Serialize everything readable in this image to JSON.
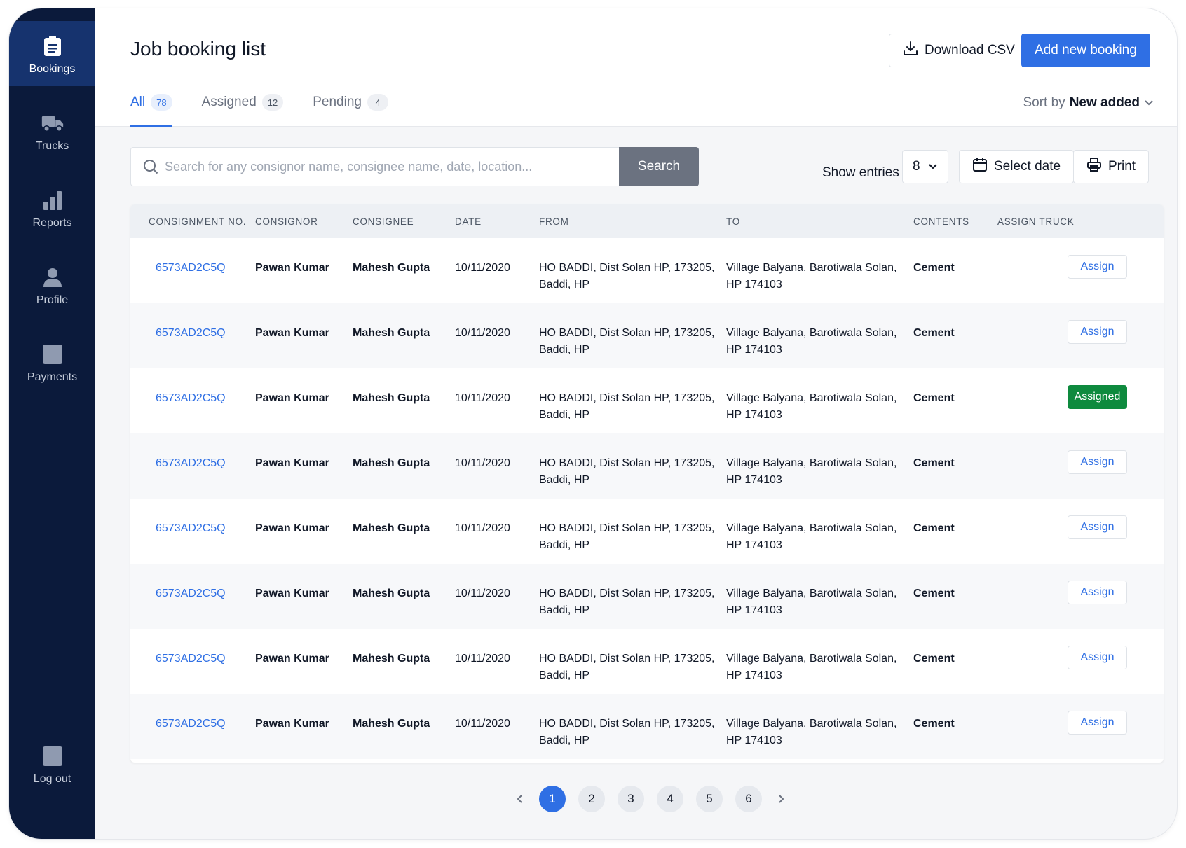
{
  "sidebar": {
    "items": [
      {
        "label": "Bookings",
        "icon": "clipboard-icon",
        "active": true
      },
      {
        "label": "Trucks",
        "icon": "truck-icon"
      },
      {
        "label": "Reports",
        "icon": "bar-chart-icon"
      },
      {
        "label": "Profile",
        "icon": "user-icon"
      },
      {
        "label": "Payments",
        "icon": "payments-icon"
      }
    ],
    "logout": {
      "label": "Log out",
      "icon": "logout-icon"
    }
  },
  "header": {
    "title": "Job booking list",
    "download_label": "Download CSV",
    "add_label": "Add new booking"
  },
  "tabs": [
    {
      "label": "All",
      "count": "78",
      "active": true
    },
    {
      "label": "Assigned",
      "count": "12"
    },
    {
      "label": "Pending",
      "count": "4"
    }
  ],
  "sort": {
    "label": "Sort by",
    "value": "New added"
  },
  "search": {
    "placeholder": "Search for any consignor name, consignee name, date, location...",
    "value": "",
    "button_label": "Search"
  },
  "toolbar": {
    "show_entries_label": "Show entries",
    "entries_value": "8",
    "select_date_label": "Select date",
    "print_label": "Print"
  },
  "table": {
    "columns": [
      "CONSIGNMENT NO.",
      "CONSIGNOR",
      "CONSIGNEE",
      "DATE",
      "FROM",
      "TO",
      "CONTENTS",
      "ASSIGN TRUCK"
    ],
    "rows": [
      {
        "consignment": "6573AD2C5Q",
        "consignor": "Pawan Kumar",
        "consignee": "Mahesh Gupta",
        "date": "10/11/2020",
        "from1": "HO BADDI, Dist Solan HP, 173205,",
        "from2": "Baddi, HP",
        "to1": "Village Balyana, Barotiwala Solan,",
        "to2": "HP 174103",
        "contents": "Cement",
        "assign": "Assign"
      },
      {
        "consignment": "6573AD2C5Q",
        "consignor": "Pawan Kumar",
        "consignee": "Mahesh Gupta",
        "date": "10/11/2020",
        "from1": "HO BADDI, Dist Solan HP, 173205,",
        "from2": "Baddi, HP",
        "to1": "Village Balyana, Barotiwala Solan,",
        "to2": "HP 174103",
        "contents": "Cement",
        "assign": "Assign"
      },
      {
        "consignment": "6573AD2C5Q",
        "consignor": "Pawan Kumar",
        "consignee": "Mahesh Gupta",
        "date": "10/11/2020",
        "from1": "HO BADDI, Dist Solan HP, 173205,",
        "from2": "Baddi, HP",
        "to1": "Village Balyana, Barotiwala Solan,",
        "to2": "HP 174103",
        "contents": "Cement",
        "assign": "Assigned"
      },
      {
        "consignment": "6573AD2C5Q",
        "consignor": "Pawan Kumar",
        "consignee": "Mahesh Gupta",
        "date": "10/11/2020",
        "from1": "HO BADDI, Dist Solan HP, 173205,",
        "from2": "Baddi, HP",
        "to1": "Village Balyana, Barotiwala Solan,",
        "to2": "HP 174103",
        "contents": "Cement",
        "assign": "Assign"
      },
      {
        "consignment": "6573AD2C5Q",
        "consignor": "Pawan Kumar",
        "consignee": "Mahesh Gupta",
        "date": "10/11/2020",
        "from1": "HO BADDI, Dist Solan HP, 173205,",
        "from2": "Baddi, HP",
        "to1": "Village Balyana, Barotiwala Solan,",
        "to2": "HP 174103",
        "contents": "Cement",
        "assign": "Assign"
      },
      {
        "consignment": "6573AD2C5Q",
        "consignor": "Pawan Kumar",
        "consignee": "Mahesh Gupta",
        "date": "10/11/2020",
        "from1": "HO BADDI, Dist Solan HP, 173205,",
        "from2": "Baddi, HP",
        "to1": "Village Balyana, Barotiwala Solan,",
        "to2": "HP 174103",
        "contents": "Cement",
        "assign": "Assign"
      },
      {
        "consignment": "6573AD2C5Q",
        "consignor": "Pawan Kumar",
        "consignee": "Mahesh Gupta",
        "date": "10/11/2020",
        "from1": "HO BADDI, Dist Solan HP, 173205,",
        "from2": "Baddi, HP",
        "to1": "Village Balyana, Barotiwala Solan,",
        "to2": "HP 174103",
        "contents": "Cement",
        "assign": "Assign"
      },
      {
        "consignment": "6573AD2C5Q",
        "consignor": "Pawan Kumar",
        "consignee": "Mahesh Gupta",
        "date": "10/11/2020",
        "from1": "HO BADDI, Dist Solan HP, 173205,",
        "from2": "Baddi, HP",
        "to1": "Village Balyana, Barotiwala Solan,",
        "to2": "HP 174103",
        "contents": "Cement",
        "assign": "Assign"
      }
    ]
  },
  "pagination": {
    "pages": [
      "1",
      "2",
      "3",
      "4",
      "5",
      "6"
    ],
    "current": "1"
  },
  "colors": {
    "accent": "#2f6fe4",
    "sidebar": "#0b1a3b",
    "sidebar_active": "#16336e",
    "assigned": "#0e8a3e"
  }
}
